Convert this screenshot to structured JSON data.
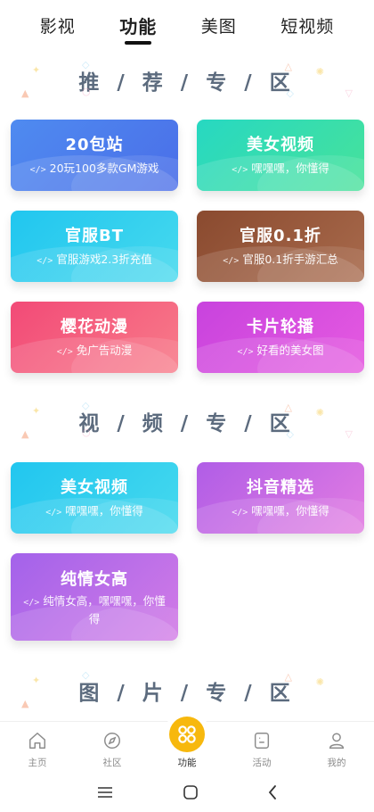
{
  "top_tabs": [
    {
      "label": "影视"
    },
    {
      "label": "功能"
    },
    {
      "label": "美图"
    },
    {
      "label": "短视频"
    }
  ],
  "sections": [
    {
      "title": "推 / 荐 / 专 / 区",
      "cards": [
        {
          "title": "20包站",
          "sub": "20玩100多款GM游戏"
        },
        {
          "title": "美女视频",
          "sub": "嘿嘿嘿，你懂得"
        },
        {
          "title": "官服BT",
          "sub": "官服游戏2.3折充值"
        },
        {
          "title": "官服0.1折",
          "sub": "官服0.1折手游汇总"
        },
        {
          "title": "樱花动漫",
          "sub": "免广告动漫"
        },
        {
          "title": "卡片轮播",
          "sub": "好看的美女图"
        }
      ]
    },
    {
      "title": "视 / 频 / 专 / 区",
      "cards": [
        {
          "title": "美女视频",
          "sub": "嘿嘿嘿，你懂得"
        },
        {
          "title": "抖音精选",
          "sub": "嘿嘿嘿，你懂得"
        },
        {
          "title": "纯情女高",
          "sub": "纯情女高，嘿嘿嘿，你懂得"
        }
      ]
    },
    {
      "title": "图 / 片 / 专 / 区",
      "cards": []
    }
  ],
  "card_icon_glyph": "</>",
  "bottom_nav": [
    {
      "label": "主页",
      "icon": "home-icon"
    },
    {
      "label": "社区",
      "icon": "compass-icon"
    },
    {
      "label": "功能",
      "icon": "grid-icon"
    },
    {
      "label": "活动",
      "icon": "activity-icon"
    },
    {
      "label": "我的",
      "icon": "person-icon"
    }
  ],
  "colors": {
    "accent": "#f7b80d",
    "section_title": "#5c6b7e"
  }
}
